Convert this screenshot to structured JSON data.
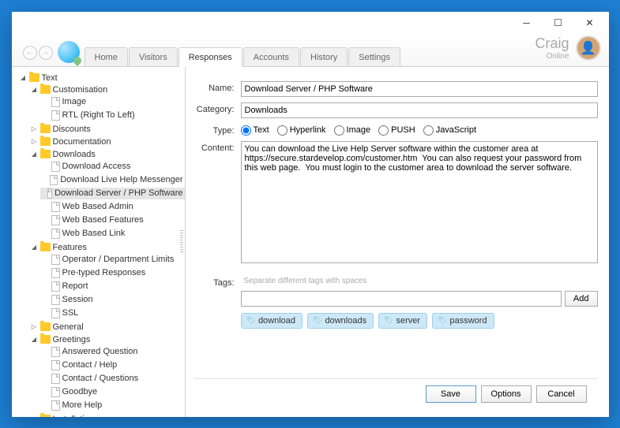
{
  "user": {
    "name": "Craig",
    "status": "Online"
  },
  "tabs": [
    "Home",
    "Visitors",
    "Responses",
    "Accounts",
    "History",
    "Settings"
  ],
  "tree": {
    "root": "Text",
    "customisation": {
      "label": "Customisation",
      "items": [
        "Image",
        "RTL (Right To Left)"
      ]
    },
    "discounts": "Discounts",
    "documentation": "Documentation",
    "downloads": {
      "label": "Downloads",
      "items": [
        "Download Access",
        "Download Live Help Messenger",
        "Download Server / PHP Software",
        "Web Based Admin",
        "Web Based Features",
        "Web Based Link"
      ]
    },
    "features": {
      "label": "Features",
      "items": [
        "Operator / Department Limits",
        "Pre-typed Responses",
        "Report",
        "Session",
        "SSL"
      ]
    },
    "general": "General",
    "greetings": {
      "label": "Greetings",
      "items": [
        "Answered Question",
        "Contact / Help",
        "Contact / Questions",
        "Goodbye",
        "More Help"
      ]
    },
    "installation": "Installation"
  },
  "form": {
    "labels": {
      "name": "Name:",
      "category": "Category:",
      "type": "Type:",
      "content": "Content:",
      "tags": "Tags:"
    },
    "name": "Download Server / PHP Software",
    "category": "Downloads",
    "type_options": [
      "Text",
      "Hyperlink",
      "Image",
      "PUSH",
      "JavaScript"
    ],
    "type_selected": "Text",
    "content": "You can download the Live Help Server software within the customer area at https://secure.stardevelop.com/customer.htm  You can also request your password from this web page.  You must login to the customer area to download the server software.",
    "tags_hint": "Separate different tags with spaces",
    "tags": [
      "download",
      "downloads",
      "server",
      "password"
    ],
    "add_label": "Add"
  },
  "footer": {
    "save": "Save",
    "options": "Options",
    "cancel": "Cancel"
  }
}
